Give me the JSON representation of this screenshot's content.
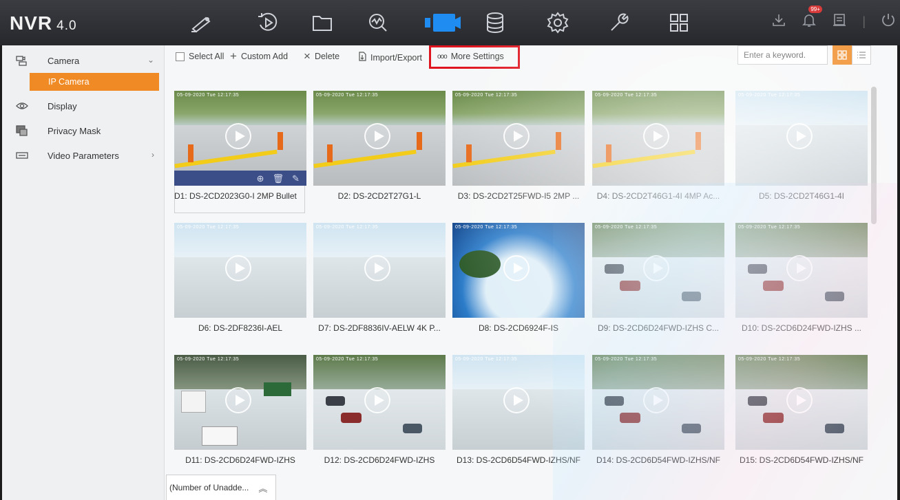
{
  "app": {
    "logo": "NVR",
    "version": "4.0"
  },
  "topbar": {
    "icons": [
      "camera-live-icon",
      "playback-icon",
      "file-folder-icon",
      "smart-analysis-icon",
      "camera-config-icon",
      "storage-icon",
      "settings-gear-icon",
      "maintenance-wrench-icon",
      "apps-grid-icon"
    ],
    "active": "camera-config-icon",
    "notification_badge": "99+",
    "accent_color": "#1e8cf0"
  },
  "sidebar": {
    "items": [
      {
        "label": "Camera",
        "icon": "camera-bank-icon",
        "chevron": "⌄"
      },
      {
        "label": "Display",
        "icon": "eye-icon"
      },
      {
        "label": "Privacy Mask",
        "icon": "privacy-mask-icon"
      },
      {
        "label": "Video Parameters",
        "icon": "video-params-icon",
        "chevron": "›"
      }
    ],
    "sub_items": [
      {
        "label": "IP Camera"
      }
    ],
    "active_color": "#f08a24"
  },
  "toolbar": {
    "select_all": "Select All",
    "custom_add": "Custom Add",
    "delete": "Delete",
    "import_export": "Import/Export",
    "more_settings": "More Settings",
    "more_settings_icon": "ooo",
    "search_placeholder": "Enter a keyword."
  },
  "cameras": [
    {
      "label": "D1: DS-2CD2023G0-I  2MP Bullet",
      "scene": "lot-barrier",
      "selected": true,
      "osd": "05-09-2020 Tue 12:17:35"
    },
    {
      "label": "D2: DS-2CD2T27G1-L",
      "scene": "lot-barrier",
      "osd": "05-09-2020 Tue 12:17:35"
    },
    {
      "label": "D3: DS-2CD2T25FWD-I5  2MP ...",
      "scene": "lot-barrier",
      "osd": "05-09-2020 Tue 12:17:35"
    },
    {
      "label": "D4: DS-2CD2T46G1-4I  4MP Ac...",
      "scene": "lot-barrier",
      "osd": "05-09-2020 Tue 12:17:35"
    },
    {
      "label": "D5: DS-2CD2T46G1-4I",
      "scene": "lot-empty",
      "osd": "05-09-2020 Tue 12:17:35"
    },
    {
      "label": "D6: DS-2DF8236I-AEL",
      "scene": "lot-empty",
      "osd": "05-09-2020 Tue 12:17:35"
    },
    {
      "label": "D7: DS-2DF8836IV-AELW  4K P...",
      "scene": "lot-empty",
      "osd": "05-09-2020 Tue 12:17:35"
    },
    {
      "label": "D8: DS-2CD6924F-IS",
      "scene": "fisheye",
      "osd": "05-09-2020 Tue 12:17:35"
    },
    {
      "label": "D9: DS-2CD6D24FWD-IZHS  C...",
      "scene": "lot-cars",
      "osd": "05-09-2020 Tue 12:17:35"
    },
    {
      "label": "D10: DS-2CD6D24FWD-IZHS  ...",
      "scene": "lot-cars",
      "osd": "05-09-2020 Tue 12:17:35"
    },
    {
      "label": "D11: DS-2CD6D24FWD-IZHS",
      "scene": "lot-truck",
      "osd": "05-09-2020 Tue 12:17:35"
    },
    {
      "label": "D12: DS-2CD6D24FWD-IZHS",
      "scene": "lot-cars",
      "osd": "05-09-2020 Tue 12:17:35"
    },
    {
      "label": "D13: DS-2CD6D54FWD-IZHS/NF",
      "scene": "lot-empty",
      "osd": "05-09-2020 Tue 12:17:35"
    },
    {
      "label": "D14: DS-2CD6D54FWD-IZHS/NF",
      "scene": "lot-cars",
      "osd": "05-09-2020 Tue 12:17:35"
    },
    {
      "label": "D15: DS-2CD6D54FWD-IZHS/NF",
      "scene": "lot-cars",
      "osd": "05-09-2020 Tue 12:17:35"
    }
  ],
  "bottom_tab": {
    "label": "(Number of Unadde...",
    "icon": "double-chevron-up-icon"
  }
}
